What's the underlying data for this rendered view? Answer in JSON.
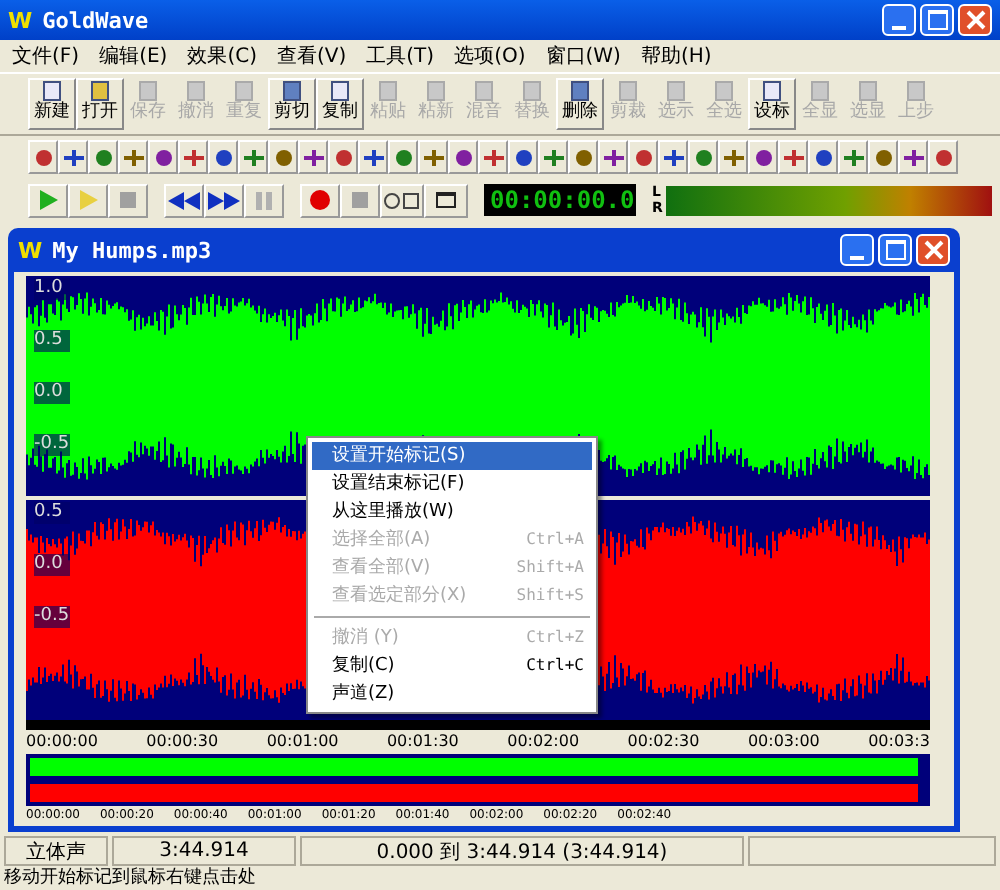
{
  "window": {
    "logo": "W",
    "title": "GoldWave"
  },
  "menu": [
    "文件(F)",
    "编辑(E)",
    "效果(C)",
    "查看(V)",
    "工具(T)",
    "选项(O)",
    "窗口(W)",
    "帮助(H)"
  ],
  "toolbar": [
    {
      "label": "新建",
      "disabled": false
    },
    {
      "label": "打开",
      "disabled": false
    },
    {
      "label": "保存",
      "disabled": true
    },
    {
      "label": "撤消",
      "disabled": true
    },
    {
      "label": "重复",
      "disabled": true
    },
    {
      "label": "剪切",
      "disabled": false
    },
    {
      "label": "复制",
      "disabled": false
    },
    {
      "label": "粘贴",
      "disabled": true
    },
    {
      "label": "粘新",
      "disabled": true
    },
    {
      "label": "混音",
      "disabled": true
    },
    {
      "label": "替换",
      "disabled": true
    },
    {
      "label": "删除",
      "disabled": false
    },
    {
      "label": "剪裁",
      "disabled": true
    },
    {
      "label": "选示",
      "disabled": true
    },
    {
      "label": "全选",
      "disabled": true
    },
    {
      "label": "设标",
      "disabled": false
    },
    {
      "label": "全显",
      "disabled": true
    },
    {
      "label": "选显",
      "disabled": true
    },
    {
      "label": "上步",
      "disabled": true
    }
  ],
  "time_display": "00:00:00.0",
  "meter": {
    "left_label": "L",
    "right_label": "R"
  },
  "document": {
    "logo": "W",
    "title": "My Humps.mp3",
    "channels": [
      {
        "color": "#00ff00",
        "axis": [
          "1.0",
          "0.5",
          "0.0",
          "-0.5"
        ]
      },
      {
        "color": "#ff0000",
        "axis": [
          "0.5",
          "0.0",
          "-0.5"
        ]
      }
    ],
    "ruler": [
      "00:00:00",
      "00:00:30",
      "00:01:00",
      "00:01:30",
      "00:02:00",
      "00:02:30",
      "00:03:00",
      "00:03:3"
    ],
    "overview_ruler": [
      "00:00:00",
      "00:00:20",
      "00:00:40",
      "00:01:00",
      "00:01:20",
      "00:01:40",
      "00:02:00",
      "00:02:20",
      "00:02:40"
    ]
  },
  "context_menu": [
    {
      "kind": "item",
      "label": "设置开始标记(S)",
      "disabled": false,
      "selected": true
    },
    {
      "kind": "item",
      "label": "设置结束标记(F)",
      "disabled": false,
      "selected": false
    },
    {
      "kind": "item",
      "label": "从这里播放(W)",
      "disabled": false,
      "selected": false
    },
    {
      "kind": "item",
      "label": "选择全部(A)",
      "shortcut": "Ctrl+A",
      "disabled": true,
      "selected": false
    },
    {
      "kind": "item",
      "label": "查看全部(V)",
      "shortcut": "Shift+A",
      "disabled": true,
      "selected": false
    },
    {
      "kind": "item",
      "label": "查看选定部分(X)",
      "shortcut": "Shift+S",
      "disabled": true,
      "selected": false
    },
    {
      "kind": "separator"
    },
    {
      "kind": "item",
      "label": "撤消 (Y)",
      "shortcut": "Ctrl+Z",
      "disabled": true,
      "selected": false
    },
    {
      "kind": "item",
      "label": "复制(C)",
      "shortcut": "Ctrl+C",
      "disabled": false,
      "selected": false
    },
    {
      "kind": "item",
      "label": "声道(Z)",
      "disabled": false,
      "selected": false
    }
  ],
  "status_bar": [
    "立体声",
    "3:44.914",
    "0.000 到 3:44.914 (3:44.914)"
  ],
  "hint": "移动开始标记到鼠标右键点击处"
}
